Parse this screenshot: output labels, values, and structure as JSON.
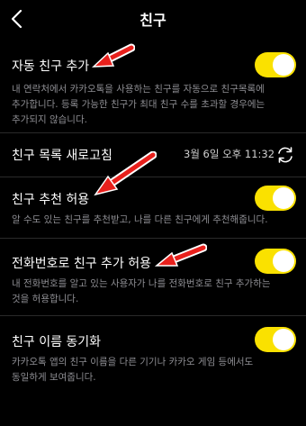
{
  "header": {
    "title": "친구"
  },
  "settings": {
    "auto_add": {
      "title": "자동 친구 추가",
      "desc_line1": "내 연락처에서 카카오톡을 사용하는 친구를 자동으로 친구목록에",
      "desc_line2": "추가합니다. 등록 가능한 친구가 최대 친구 수를 초과할 경우에는",
      "desc_line3": "추가되지 않습니다.",
      "enabled": true
    },
    "refresh": {
      "title": "친구 목록 새로고침",
      "time": "3월 6일 오후 11:32"
    },
    "recommend": {
      "title": "친구 추천 허용",
      "desc_line1": "알 수도 있는 친구를 추천받고, 나를 다른 친구에게 추천해줍니다.",
      "enabled": true
    },
    "phone_add": {
      "title": "전화번호로 친구 추가 허용",
      "desc_line1": "내 전화번호를 알고 있는 사용자가 나를 전화번호로 친구 추가하는",
      "desc_line2": "것을 허용합니다.",
      "enabled": true
    },
    "name_sync": {
      "title": "친구 이름 동기화",
      "desc_line1": "카카오톡 앱의 친구 이름을 다른 기기나 카카오 게임 등에서도",
      "desc_line2": "동일하게 보여줍니다.",
      "enabled": true
    }
  },
  "colors": {
    "background": "#000000",
    "toggle_on": "#fae100",
    "description": "#8e8e93",
    "annotation_arrow": "#e8201c"
  },
  "icons": {
    "back": "chevron-left-icon",
    "refresh": "refresh-icon"
  }
}
